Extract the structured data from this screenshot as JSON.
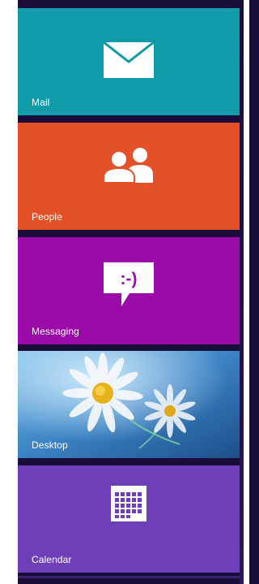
{
  "tiles": [
    {
      "label": "Mail",
      "icon": "mail-icon",
      "color": "#0e9aa7"
    },
    {
      "label": "People",
      "icon": "people-icon",
      "color": "#e45129"
    },
    {
      "label": "Messaging",
      "icon": "messaging-icon",
      "color": "#9b0aa8"
    },
    {
      "label": "Desktop",
      "icon": "desktop-wallpaper",
      "color": "#3b82c4"
    },
    {
      "label": "Calendar",
      "icon": "calendar-icon",
      "color": "#6e3fb8"
    }
  ],
  "messaging_glyph": ":-)",
  "colors": {
    "background": "#1b0d3a",
    "edge": "#ffffff"
  }
}
